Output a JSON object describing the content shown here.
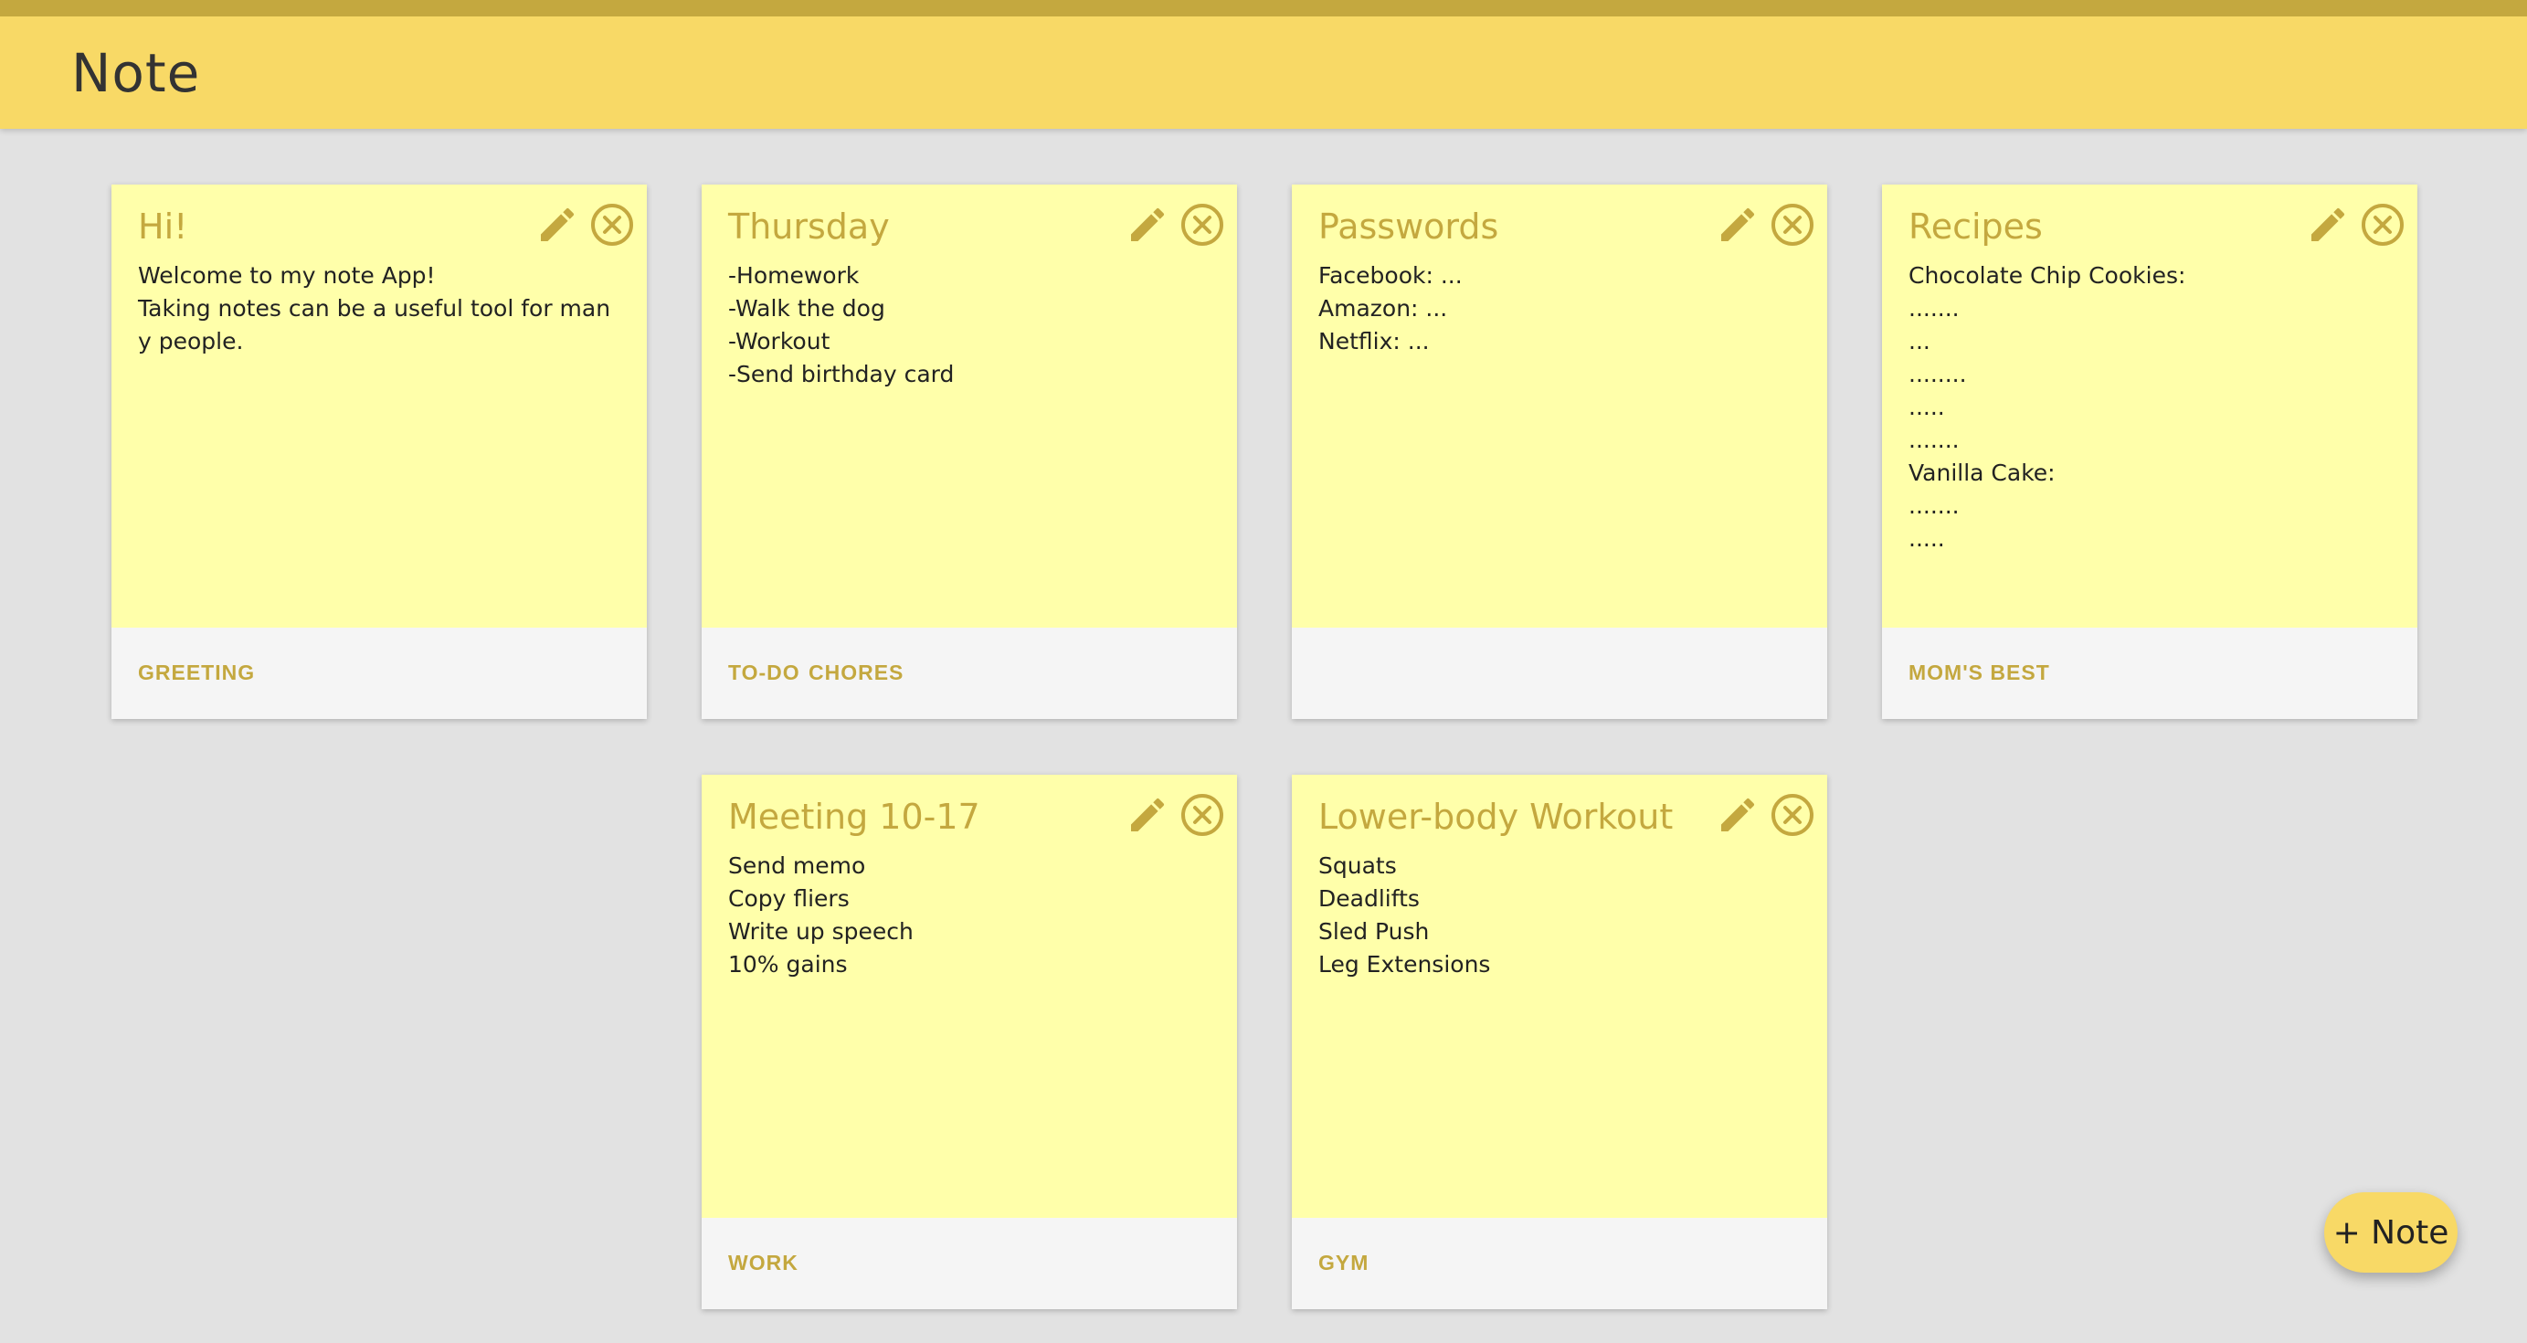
{
  "app": {
    "title": "Note"
  },
  "fab": {
    "label": "+ Note"
  },
  "colors": {
    "header": "#f8d966",
    "header_border": "#c4a83f",
    "accent": "#c4a83f",
    "card_body": "#ffffaa",
    "card_footer": "#f5f5f5",
    "background": "#e2e2e2"
  },
  "icons": {
    "edit": "pencil-icon",
    "delete": "close-circle-icon"
  },
  "notes": [
    {
      "title": "Hi!",
      "lines": [
        "Welcome to my note App!",
        "Taking notes can be a useful tool for many people."
      ],
      "tags": [
        "GREETING"
      ]
    },
    {
      "title": "Thursday",
      "lines": [
        "-Homework",
        "-Walk the dog",
        "-Workout",
        "-Send birthday card"
      ],
      "tags": [
        "TO-DO",
        "CHORES"
      ]
    },
    {
      "title": "Passwords",
      "lines": [
        "Facebook: ...",
        "Amazon: ...",
        "Netflix: ..."
      ],
      "tags": []
    },
    {
      "title": "Recipes",
      "lines": [
        "Chocolate Chip Cookies:",
        ".......",
        "...",
        "........",
        ".....",
        ".......",
        "Vanilla Cake:",
        ".......",
        "....."
      ],
      "tags": [
        "MOM'S BEST"
      ]
    },
    {
      "title": "Meeting 10-17",
      "lines": [
        "Send memo",
        "Copy fliers",
        "Write up speech",
        "10% gains"
      ],
      "tags": [
        "WORK"
      ]
    },
    {
      "title": "Lower-body Workout",
      "lines": [
        "Squats",
        "Deadlifts",
        "Sled Push",
        "Leg Extensions"
      ],
      "tags": [
        "GYM"
      ]
    }
  ]
}
